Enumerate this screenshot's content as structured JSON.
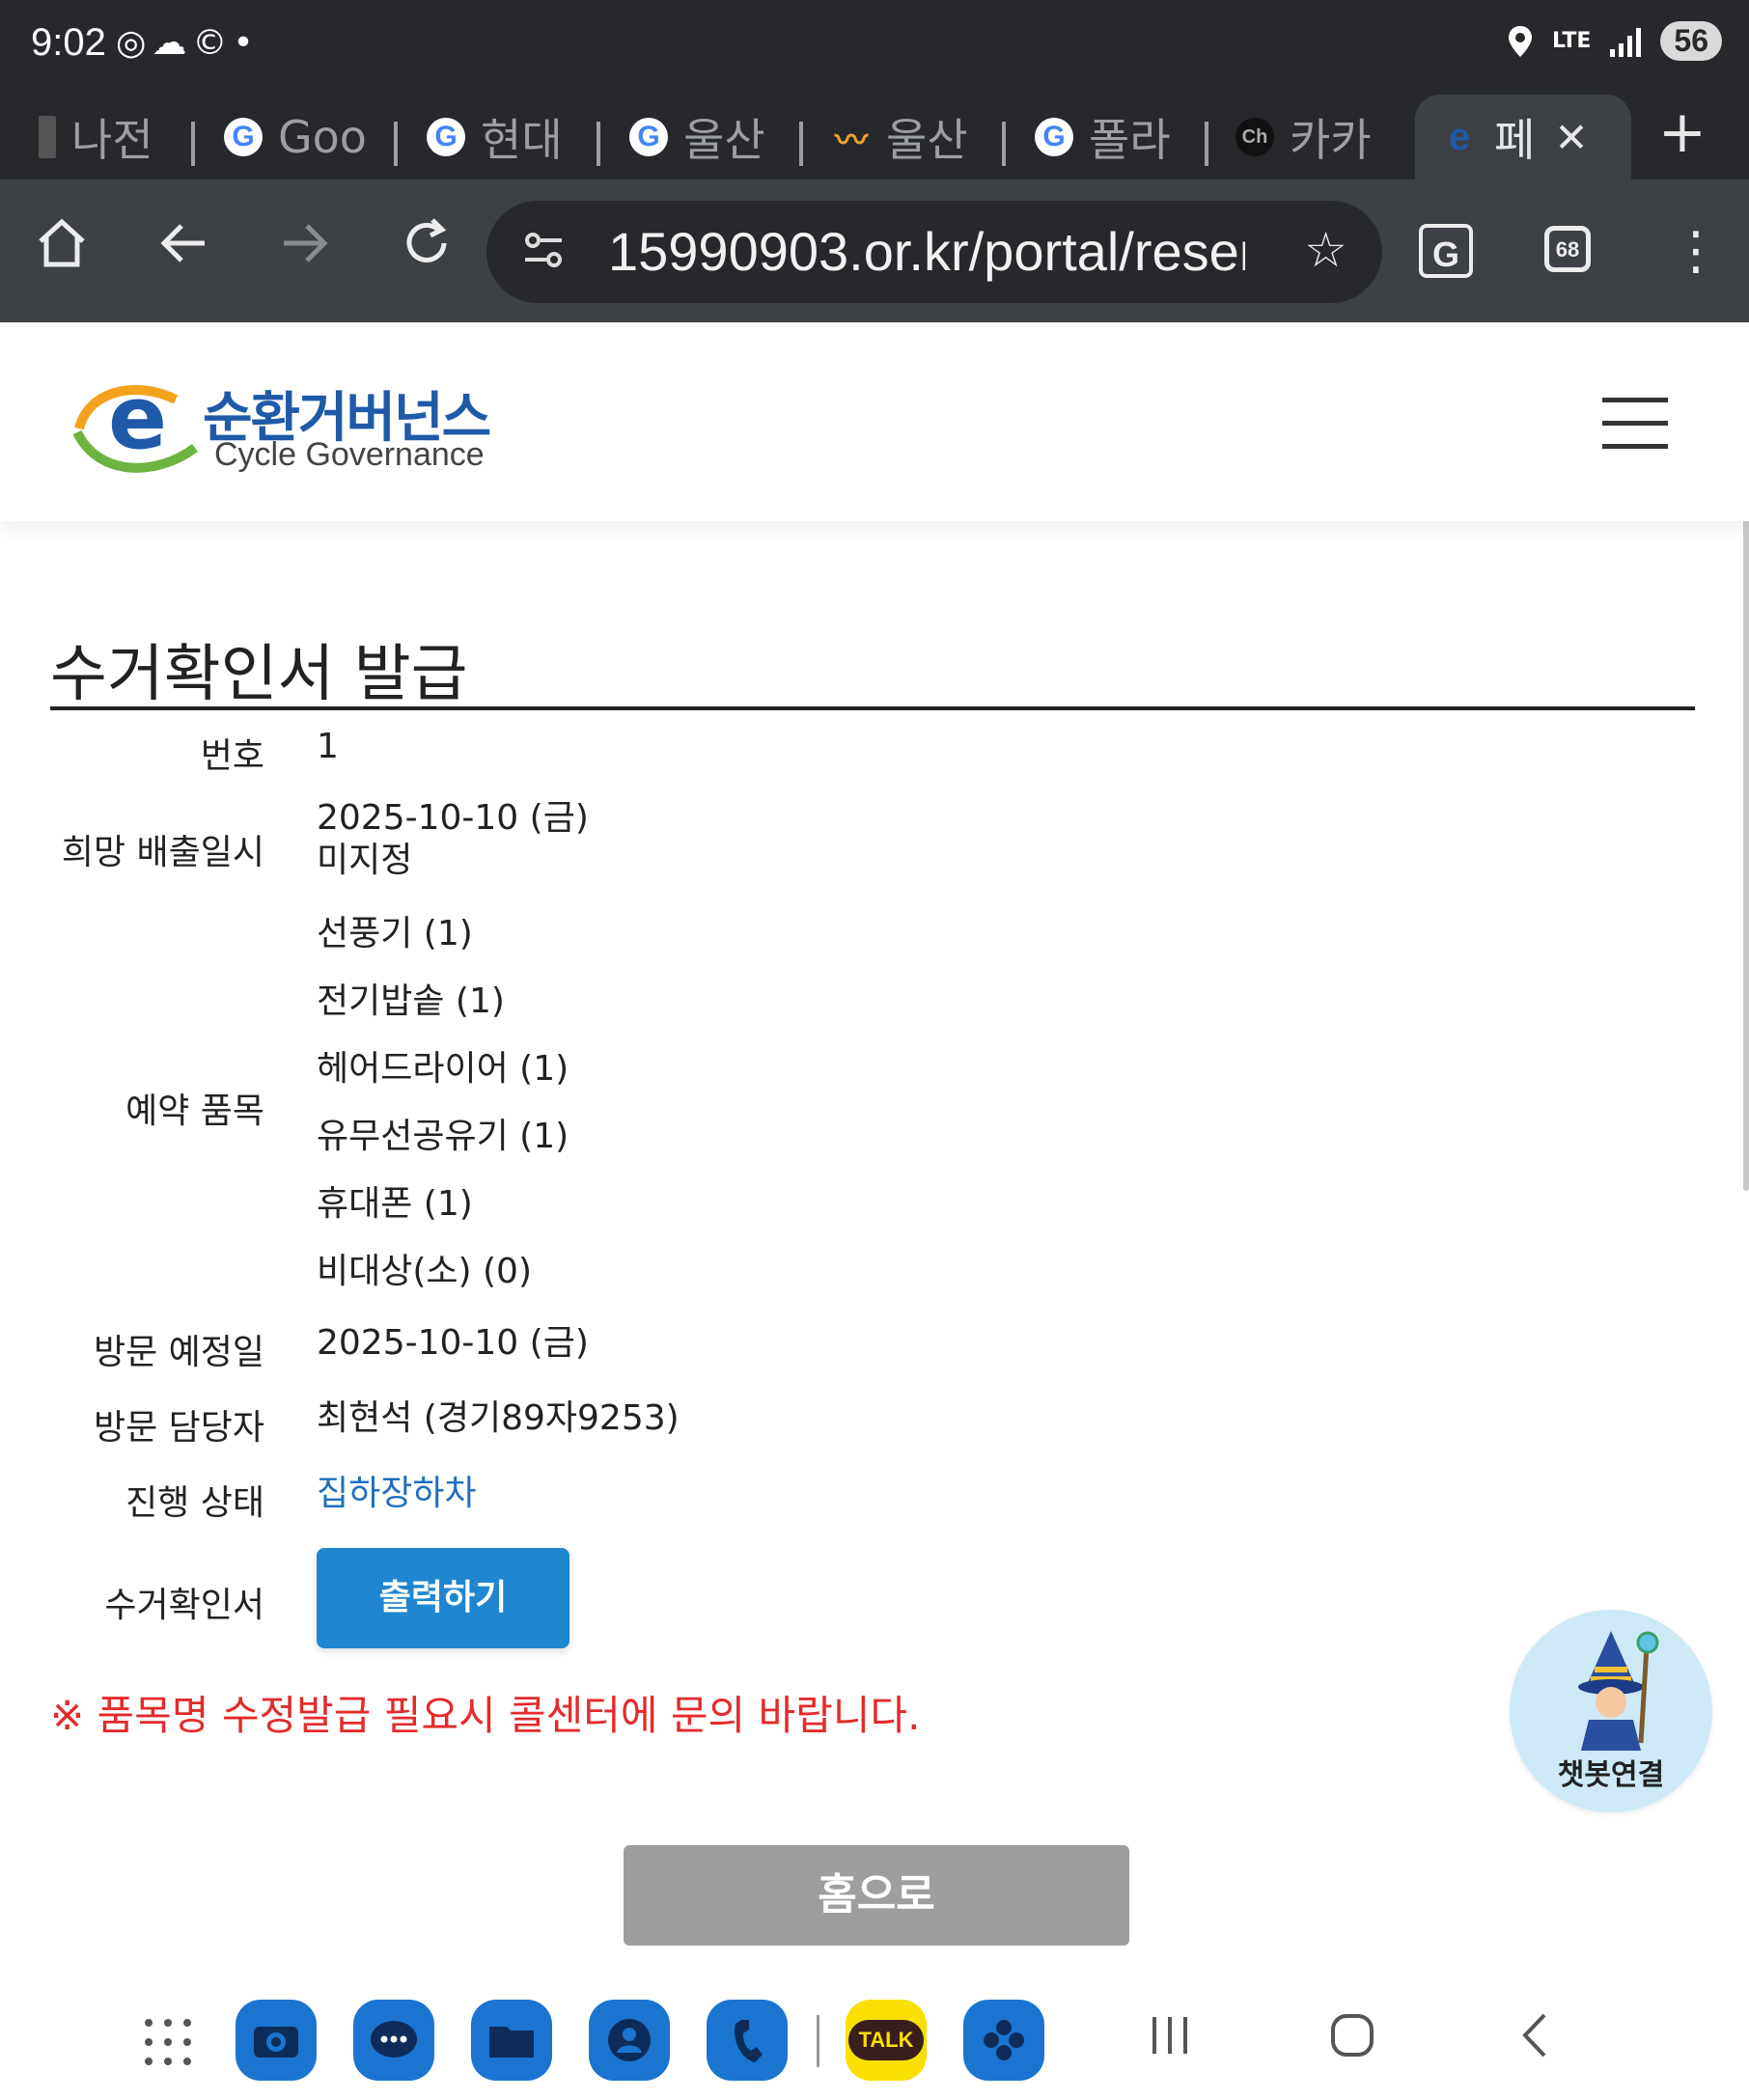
{
  "status_bar": {
    "time": "9:02",
    "left_icons": "◎☁©•",
    "network": "LTE",
    "battery": "56"
  },
  "tabs": [
    {
      "label": "나전",
      "icon": "bar-icon"
    },
    {
      "label": "Goo",
      "icon": "google-icon",
      "glyph": "G"
    },
    {
      "label": "현대",
      "icon": "google-icon",
      "glyph": "G"
    },
    {
      "label": "울산",
      "icon": "google-icon",
      "glyph": "G"
    },
    {
      "label": "울산",
      "icon": "wave-icon",
      "glyph": "〰"
    },
    {
      "label": "폴라",
      "icon": "google-icon",
      "glyph": "G"
    },
    {
      "label": "카카",
      "icon": "channel-icon",
      "glyph": "Ch"
    },
    {
      "label": "페",
      "icon": "site-icon",
      "glyph": "e",
      "active": true
    }
  ],
  "browser": {
    "url": "15990903.or.kr/portal/reser",
    "tab_count": "68",
    "translate_glyph": "G"
  },
  "site": {
    "logo_kr": "순환거버넌스",
    "logo_en": "Cycle Governance"
  },
  "page": {
    "title": "수거확인서 발급",
    "fields": {
      "number_label": "번호",
      "number_value": "1",
      "desired_label": "희망 배출일시",
      "desired_date": "2025-10-10 (금)",
      "desired_time": "미지정",
      "items_label": "예약 품목",
      "items": [
        "선풍기 (1)",
        "전기밥솥 (1)",
        "헤어드라이어 (1)",
        "유무선공유기 (1)",
        "휴대폰 (1)",
        "비대상(소) (0)"
      ],
      "visit_date_label": "방문 예정일",
      "visit_date_value": "2025-10-10 (금)",
      "visitor_label": "방문 담당자",
      "visitor_value": "최현석 (경기89자9253)",
      "status_label": "진행 상태",
      "status_value": "집하장하차",
      "cert_label": "수거확인서"
    },
    "print_button": "출력하기",
    "notice": "※ 품목명 수정발급 필요시 콜센터에 문의 바랍니다.",
    "home_button": "홈으로",
    "chatbot_label": "챗봇연결"
  },
  "dock": {
    "apps": [
      "camera",
      "messages",
      "files",
      "contacts",
      "phone",
      "kakaotalk",
      "gallery"
    ],
    "kakao_label": "TALK"
  },
  "colors": {
    "browser_dark": "#26282c",
    "toolbar": "#3d4044",
    "accent_blue": "#1f86cf",
    "status_blue": "#1f6fbf",
    "notice_red": "#e42a2a",
    "home_gray": "#9e9e9e"
  }
}
